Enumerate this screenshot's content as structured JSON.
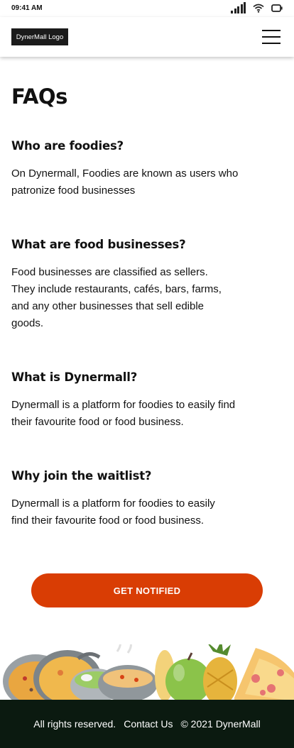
{
  "status_bar": {
    "time": "09:41 AM",
    "icons": [
      "cellular-signal-icon",
      "wifi-icon",
      "battery-icon"
    ]
  },
  "header": {
    "logo_text": "DynerMall Logo",
    "menu_icon": "hamburger-menu-icon"
  },
  "page": {
    "title": "FAQs"
  },
  "faqs": [
    {
      "question": "Who are foodies?",
      "answer": "On Dynermall, Foodies are known as users who\npatronize food businesses"
    },
    {
      "question": "What are food businesses?",
      "answer": "Food businesses are classified as sellers.\nThey include restaurants, cafés, bars, farms,\nand any other businesses that sell edible\ngoods."
    },
    {
      "question": "What is Dynermall?",
      "answer": "Dynermall is a platform for foodies to easily find\ntheir favourite food or food business."
    },
    {
      "question": "Why join the waitlist?",
      "answer": "Dynermall is a platform for foodies to easily\nfind their favourite food or food business."
    }
  ],
  "cta": {
    "label": "GET NOTIFIED",
    "color": "#d93d04"
  },
  "footer": {
    "rights": "All rights reserved.",
    "contact": "Contact Us",
    "copyright": "© 2021 DynerMall",
    "background": "#0b1a10"
  }
}
